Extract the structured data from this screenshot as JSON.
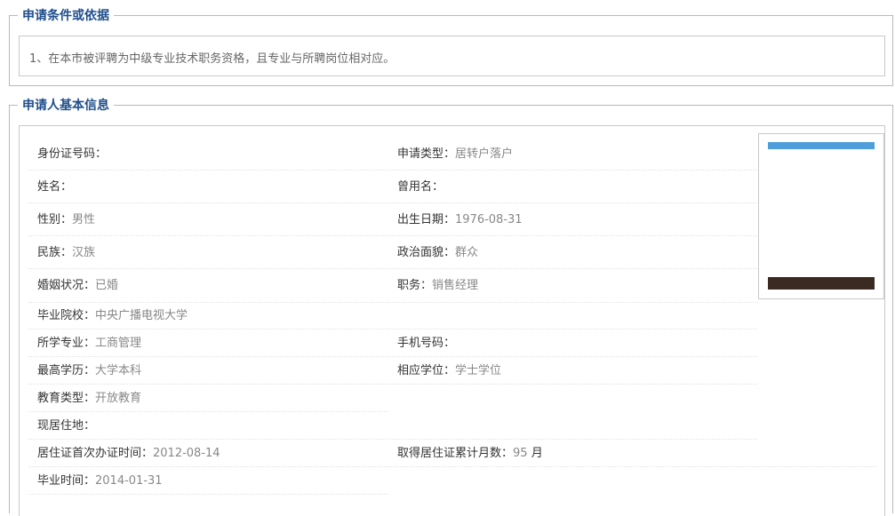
{
  "conditions": {
    "legend": "申请条件或依据",
    "text": "1、在本市被评聘为中级专业技术职务资格，且专业与所聘岗位相对应。"
  },
  "basic_info": {
    "legend": "申请人基本信息",
    "id_number": {
      "label": "身份证号码：",
      "value": ""
    },
    "apply_type": {
      "label": "申请类型：",
      "value": "居转户落户"
    },
    "name": {
      "label": "姓名：",
      "value": ""
    },
    "former_name": {
      "label": "曾用名：",
      "value": ""
    },
    "gender": {
      "label": "性别：",
      "value": "男性"
    },
    "birth_date": {
      "label": "出生日期：",
      "value": "1976-08-31"
    },
    "ethnicity": {
      "label": "民族：",
      "value": "汉族"
    },
    "political_status": {
      "label": "政治面貌：",
      "value": "群众"
    },
    "marital_status": {
      "label": "婚姻状况：",
      "value": "已婚"
    },
    "position": {
      "label": "职务：",
      "value": "销售经理"
    },
    "school": {
      "label": "毕业院校：",
      "value": "中央广播电视大学"
    },
    "major": {
      "label": "所学专业：",
      "value": "工商管理"
    },
    "mobile": {
      "label": "手机号码：",
      "value": ""
    },
    "education": {
      "label": "最高学历：",
      "value": "大学本科"
    },
    "degree": {
      "label": "相应学位：",
      "value": "学士学位"
    },
    "edu_type": {
      "label": "教育类型：",
      "value": "开放教育"
    },
    "address": {
      "label": "现居住地：",
      "value": ""
    },
    "permit_first_date": {
      "label": "居住证首次办证时间：",
      "value": "2012-08-14"
    },
    "permit_months": {
      "label": "取得居住证累计月数：",
      "value": "95",
      "unit": " 月"
    },
    "graduation_date": {
      "label": "毕业时间：",
      "value": "2014-01-31"
    }
  },
  "colors": {
    "legend_text": "#1f4e8c",
    "value_text": "#888888",
    "photo_top_bar": "#4f9edb",
    "photo_bottom_bar": "#3a2a22"
  }
}
